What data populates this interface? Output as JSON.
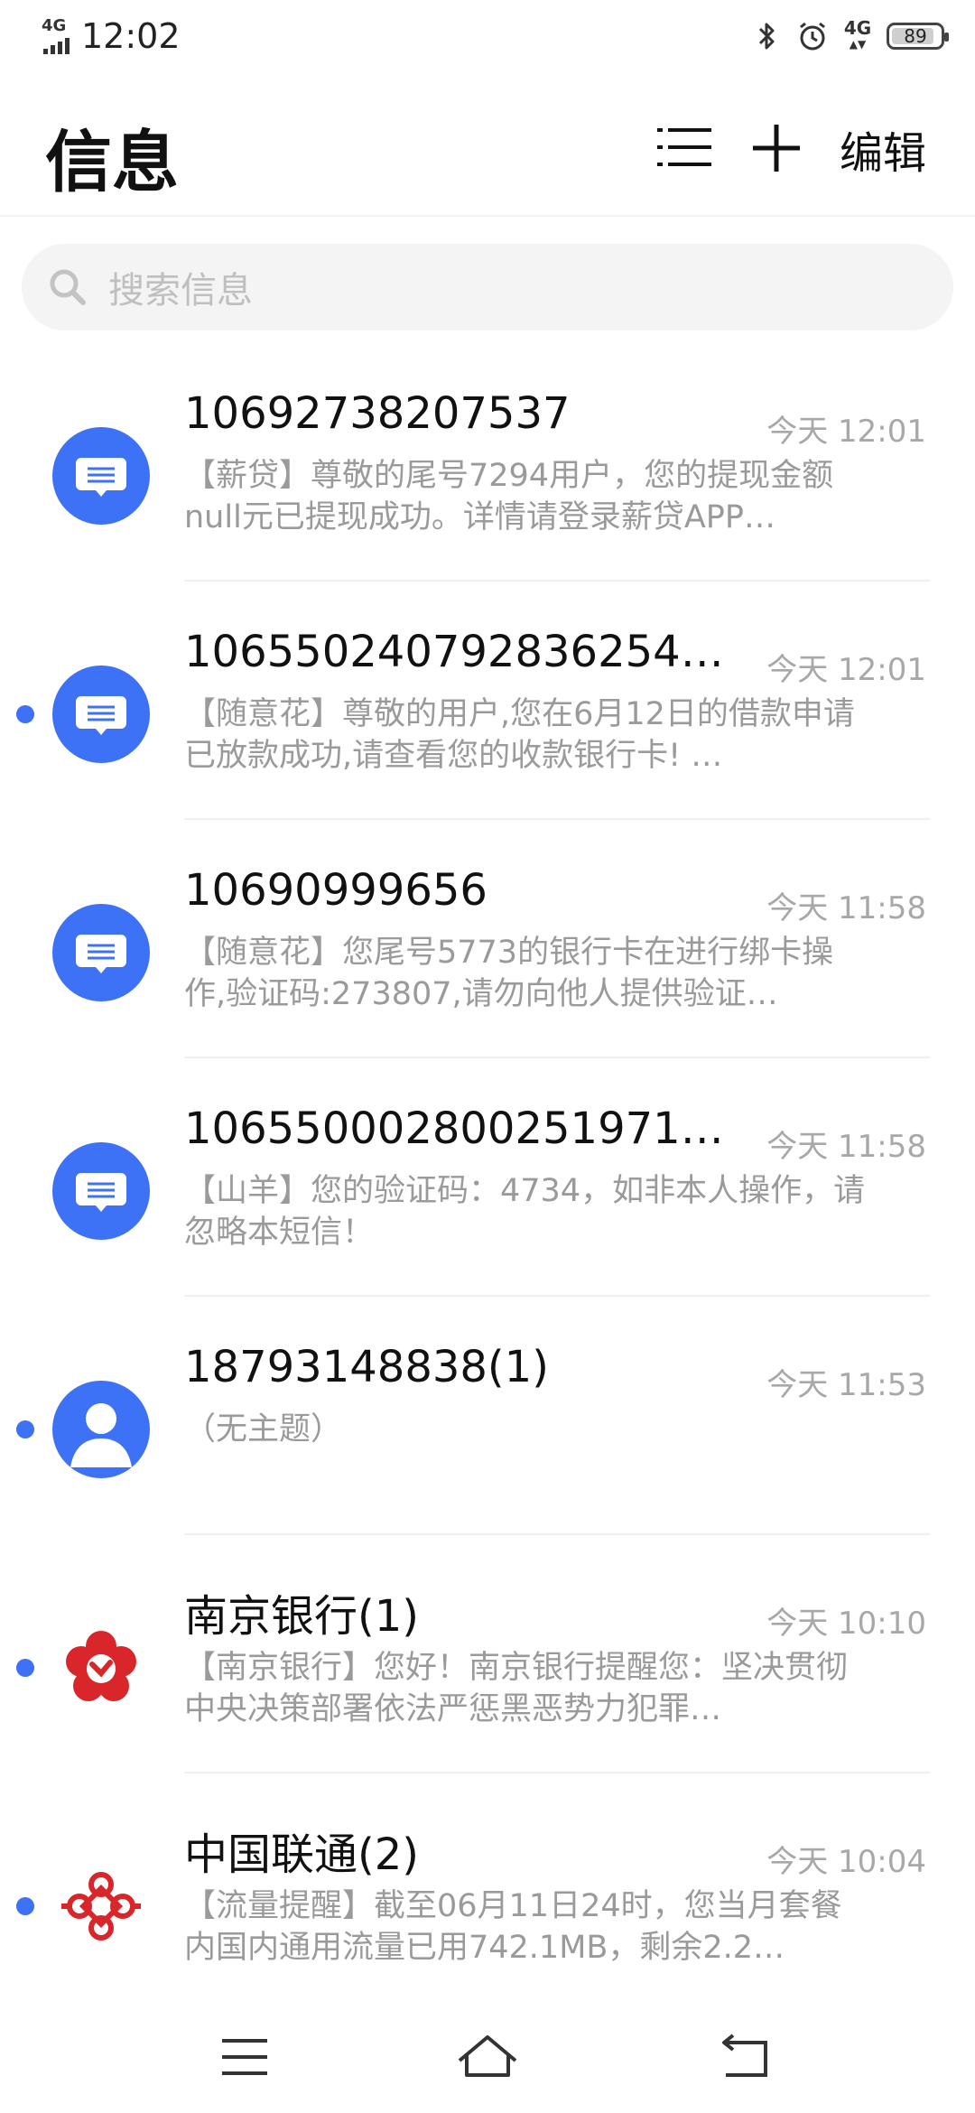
{
  "status_bar": {
    "time": "12:02",
    "network_left": "4G",
    "network_right": "4G",
    "battery": "89",
    "icons": [
      "signal-icon",
      "bluetooth-icon",
      "alarm-icon",
      "network-4g-icon",
      "battery-icon"
    ]
  },
  "header": {
    "title": "信息",
    "edit_label": "编辑",
    "icons": [
      "list-menu-icon",
      "plus-icon"
    ]
  },
  "search": {
    "placeholder": "搜索信息",
    "icon": "search-icon"
  },
  "messages": [
    {
      "sender": "10692738207537",
      "time": "今天 12:01",
      "preview": "【薪贷】尊敬的尾号7294用户，您的提现金额null元已提现成功。详情请登录薪贷APP…",
      "unread": false,
      "avatar": "message-bubble-icon"
    },
    {
      "sender": "106550240792836254…",
      "time": "今天 12:01",
      "preview": "【随意花】尊敬的用户,您在6月12日的借款申请已放款成功,请查看您的收款银行卡! …",
      "unread": true,
      "avatar": "message-bubble-icon"
    },
    {
      "sender": "10690999656",
      "time": "今天 11:58",
      "preview": "【随意花】您尾号5773的银行卡在进行绑卡操作,验证码:273807,请勿向他人提供验证…",
      "unread": false,
      "avatar": "message-bubble-icon"
    },
    {
      "sender": "106550002800251971…",
      "time": "今天 11:58",
      "preview": "【山羊】您的验证码：4734，如非本人操作，请忽略本短信！",
      "unread": false,
      "avatar": "message-bubble-icon"
    },
    {
      "sender": "18793148838(1)",
      "time": "今天 11:53",
      "preview": "（无主题）",
      "unread": true,
      "avatar": "person-icon"
    },
    {
      "sender": "南京银行(1)",
      "time": "今天 10:10",
      "preview": "【南京银行】您好！南京银行提醒您：坚决贯彻中央决策部署依法严惩黑恶势力犯罪…",
      "unread": true,
      "avatar": "bank-of-nanjing-logo"
    },
    {
      "sender": "中国联通(2)",
      "time": "今天 10:04",
      "preview": "【流量提醒】截至06月11日24时，您当月套餐内国内通用流量已用742.1MB，剩余2.2…",
      "unread": true,
      "avatar": "china-unicom-logo"
    }
  ],
  "nav_bar": {
    "icons": [
      "nav-menu-icon",
      "nav-home-icon",
      "nav-back-icon"
    ]
  },
  "colors": {
    "accent": "#3d72f6",
    "logo_red": "#d9262b",
    "muted_text": "#9a9a9a"
  }
}
